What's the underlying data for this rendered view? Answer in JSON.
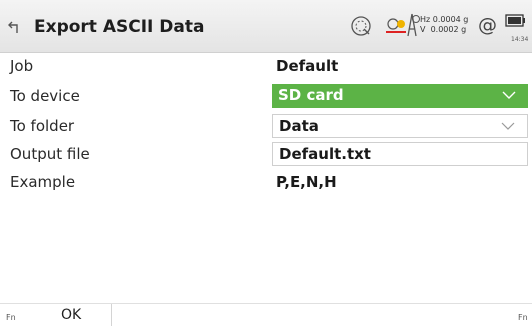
{
  "header": {
    "title": "Export ASCII Data",
    "hz_label": "Hz",
    "hz_value": "0.0004 g",
    "v_label": "V",
    "v_value": "0.0002 g",
    "time": "14:34",
    "icons": [
      "back-icon",
      "tilt-compensation-icon",
      "prism-target-icon",
      "ppm-station-icon",
      "at-sign-icon",
      "battery-icon"
    ]
  },
  "form": {
    "job": {
      "label": "Job",
      "value": "Default"
    },
    "to_device": {
      "label": "To device",
      "value": "SD card"
    },
    "to_folder": {
      "label": "To folder",
      "value": "Data"
    },
    "output_file": {
      "label": "Output file",
      "value": "Default.txt"
    },
    "example": {
      "label": "Example",
      "value": "P,E,N,H"
    }
  },
  "footer": {
    "fn_left": "Fn",
    "ok_label": "OK",
    "fn_right": "Fn"
  },
  "colors": {
    "accent_green": "#5cb346",
    "titlebar": "#ececec"
  }
}
